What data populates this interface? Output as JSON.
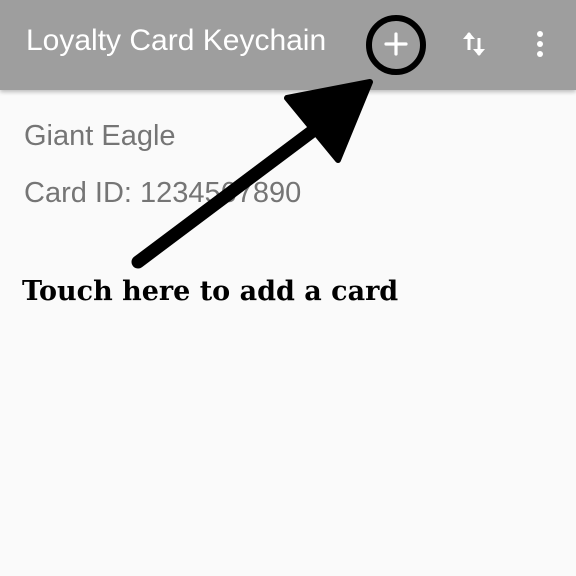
{
  "app_bar": {
    "title": "Loyalty Card Keychain",
    "background": "#9e9e9e",
    "actions": [
      {
        "icon": "plus-icon"
      },
      {
        "icon": "sort-icon"
      },
      {
        "icon": "more-vert-icon"
      }
    ]
  },
  "card_list": {
    "items": [
      {
        "name": "Giant Eagle",
        "card_id": "Card ID: 1234567890"
      }
    ]
  },
  "annotation": {
    "text": "Touch here to add a card",
    "color": "#000000"
  }
}
